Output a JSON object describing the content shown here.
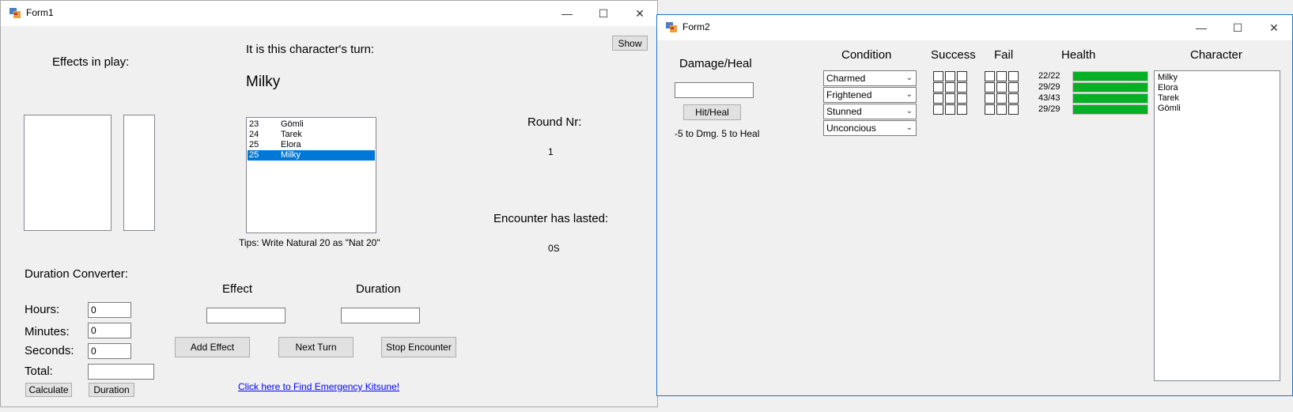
{
  "form1": {
    "title": "Form1",
    "show_button": "Show",
    "effects_in_play_label": "Effects in play:",
    "turn_label": "It is this character's turn:",
    "current_character": "Milky",
    "initiative_list": [
      {
        "initiative": "23",
        "name": "Gömli",
        "selected": false
      },
      {
        "initiative": "24",
        "name": "Tarek",
        "selected": false
      },
      {
        "initiative": "25",
        "name": "Elora",
        "selected": false
      },
      {
        "initiative": "25",
        "name": "Milky",
        "selected": true
      }
    ],
    "tips": "Tips: Write Natural 20 as \"Nat 20\"",
    "round_label": "Round Nr:",
    "round_value": "1",
    "encounter_label": "Encounter has lasted:",
    "encounter_value": "0S",
    "duration_converter_label": "Duration Converter:",
    "hours_label": "Hours:",
    "hours_value": "0",
    "minutes_label": "Minutes:",
    "minutes_value": "0",
    "seconds_label": "Seconds:",
    "seconds_value": "0",
    "total_label": "Total:",
    "total_value": "",
    "calculate_button": "Calculate",
    "duration_button": "Duration",
    "effect_label": "Effect",
    "duration_label": "Duration",
    "effect_value": "",
    "duration_value": "",
    "add_effect_button": "Add Effect",
    "next_turn_button": "Next Turn",
    "stop_encounter_button": "Stop Encounter",
    "kitsune_link": "Click here to Find Emergency Kitsune!"
  },
  "form2": {
    "title": "Form2",
    "damage_heal_label": "Damage/Heal",
    "damage_value": "",
    "hit_heal_button": "Hit/Heal",
    "hint": "-5 to Dmg. 5 to Heal",
    "condition_label": "Condition",
    "success_label": "Success",
    "fail_label": "Fail",
    "health_label": "Health",
    "character_label": "Character",
    "rows": [
      {
        "condition": "Charmed",
        "health": "22/22",
        "health_fraction": 1.0
      },
      {
        "condition": "Frightened",
        "health": "29/29",
        "health_fraction": 1.0
      },
      {
        "condition": "Stunned",
        "health": "43/43",
        "health_fraction": 1.0
      },
      {
        "condition": "Unconcious",
        "health": "29/29",
        "health_fraction": 1.0
      }
    ],
    "characters": [
      "Milky",
      "Elora",
      "Tarek",
      "Gömli"
    ]
  },
  "colors": {
    "accent": "#0078d7",
    "health_bar": "#06b025",
    "link": "#0000ff"
  }
}
